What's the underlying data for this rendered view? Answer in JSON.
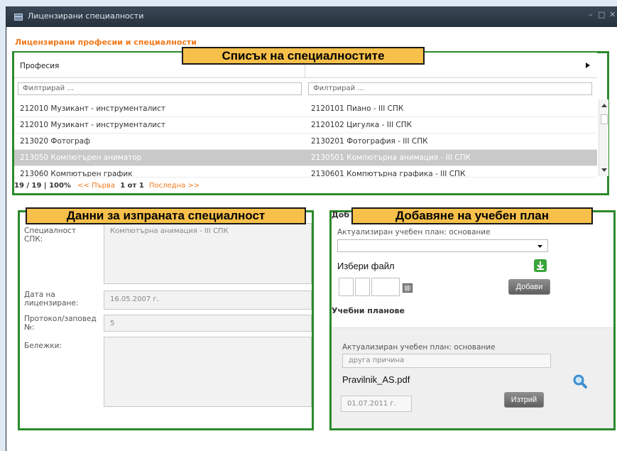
{
  "window": {
    "title": "Лицензирани специалности",
    "controls": [
      "–",
      "□",
      "✕"
    ]
  },
  "section_title": "Лицензирани професии и специалности",
  "callouts": {
    "list": "Списък на специалностите",
    "details": "Данни за изпраната специалност",
    "add_plan": "Добавяне на учебен план"
  },
  "list": {
    "col_profession": "Професия",
    "filter_placeholder": "Филтрирай ...",
    "rows": [
      {
        "profession": "212010 Музикант - инструменталист",
        "specialty": "2120101 Пиано - III СПК"
      },
      {
        "profession": "212010 Музикант - инструменталист",
        "specialty": "2120102 Цигулка - III СПК"
      },
      {
        "profession": "213020 Фотограф",
        "specialty": "2130201 Фотография - III СПК"
      },
      {
        "profession": "213050 Компютърен аниматор",
        "specialty": "2130501 Компютърна анимация - III СПК"
      },
      {
        "profession": "213060 Компютърен график",
        "specialty": "2130601 Компютърна графика - III СПК"
      }
    ],
    "pager": {
      "info": "19 / 19 | 100%",
      "first": "<< Първа",
      "current": "1 от 1",
      "last": "Последна >>"
    }
  },
  "details": {
    "specialty_label": "Специалност СПК:",
    "specialty_value": "Компютърна анимация - III СПК",
    "date_label": "Дата на лицензиране:",
    "date_value": "16.05.2007 г.",
    "order_label": "Протокол/заповед №:",
    "order_value": "5",
    "notes_label": "Бележки:"
  },
  "add_plan": {
    "partial_heading": "Доб",
    "basis_label": "Актуализиран учебен план: основание",
    "choose_file": "Избери файл",
    "add_button": "Добави",
    "plans_heading": "Учебни планове",
    "plan": {
      "basis_label": "Актуализиран учебен план: основание",
      "basis_value": "друга причина",
      "file_name": "Pravilnik_AS.pdf",
      "date": "01.07.2011 г.",
      "delete_button": "Изтрий"
    }
  },
  "colors": {
    "orange": "#f07a1c",
    "green_frame": "#2b8a2b",
    "callout_fill": "#f7c04a",
    "selected_row": "#c9c9c9"
  }
}
